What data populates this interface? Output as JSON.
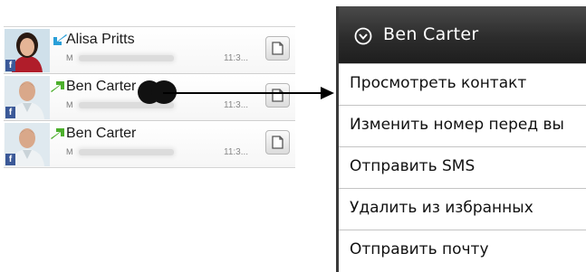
{
  "call_log": {
    "entries": [
      {
        "name": "Alisa Pritts",
        "number_type": "M",
        "time": "11:3...",
        "avatar_icon": "contact-photo-woman",
        "badge_icon": "facebook-badge-icon",
        "call_icon": "incoming-call-icon",
        "action_icon": "sms-icon"
      },
      {
        "name": "Ben  Carter",
        "number_type": "M",
        "time": "11:3...",
        "avatar_icon": "contact-photo-man",
        "badge_icon": "facebook-badge-icon",
        "call_icon": "outgoing-call-icon",
        "action_icon": "sms-icon"
      },
      {
        "name": "Ben  Carter",
        "number_type": "M",
        "time": "11:3...",
        "avatar_icon": "contact-photo-man",
        "badge_icon": "facebook-badge-icon",
        "call_icon": "outgoing-call-icon",
        "action_icon": "sms-icon"
      }
    ],
    "badge_letter": "f"
  },
  "context_menu": {
    "title": "Ben  Carter",
    "header_icon": "chevron-down-circle-icon",
    "items": [
      {
        "label": "Просмотреть контакт"
      },
      {
        "label": "Изменить номер перед вы"
      },
      {
        "label": "Отправить SMS"
      },
      {
        "label": "Удалить из избранных"
      },
      {
        "label": "Отправить почту"
      }
    ]
  },
  "colors": {
    "header_background": "#2c2c2c",
    "facebook_blue": "#3b5998",
    "call_arrow_green": "#4caf2c",
    "call_arrow_blue": "#2a9fd8"
  }
}
